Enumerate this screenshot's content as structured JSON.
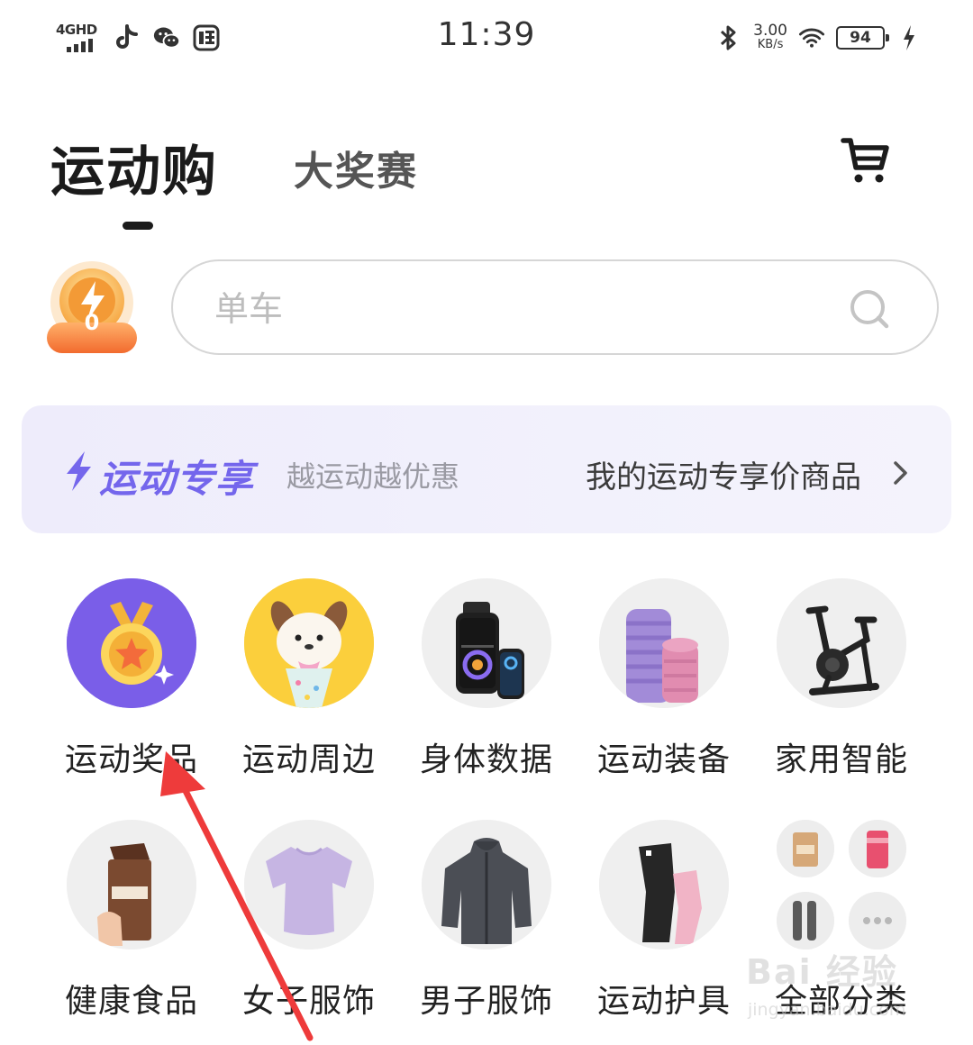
{
  "status_bar": {
    "network": "4GHD",
    "time": "11:39",
    "speed_value": "3.00",
    "speed_unit": "KB/s",
    "battery": "94",
    "left_icons": [
      "douyin-icon",
      "wechat-icon",
      "vip-shop-icon"
    ],
    "right_icons": [
      "bluetooth-icon",
      "wifi-icon",
      "charging-icon"
    ]
  },
  "header": {
    "tabs": [
      {
        "label": "运动购",
        "active": true
      },
      {
        "label": "大奖赛",
        "active": false
      }
    ],
    "cart_icon": "cart-icon"
  },
  "energy": {
    "count": "0",
    "icon": "lightning-coin-icon"
  },
  "search": {
    "placeholder": "单车",
    "value": ""
  },
  "banner": {
    "title": "运动专享",
    "subtitle": "越运动越优惠",
    "link": "我的运动专享价商品",
    "accent": "#7466ec"
  },
  "categories": [
    {
      "label": "运动奖品",
      "icon": "medal-icon"
    },
    {
      "label": "运动周边",
      "icon": "plush-toy-icon"
    },
    {
      "label": "身体数据",
      "icon": "smartwatch-icon"
    },
    {
      "label": "运动装备",
      "icon": "foam-roller-icon"
    },
    {
      "label": "家用智能",
      "icon": "exercise-bike-icon"
    },
    {
      "label": "健康食品",
      "icon": "protein-bar-icon"
    },
    {
      "label": "女子服饰",
      "icon": "women-tshirt-icon"
    },
    {
      "label": "男子服饰",
      "icon": "men-jacket-icon"
    },
    {
      "label": "运动护具",
      "icon": "knee-brace-icon"
    },
    {
      "label": "全部分类",
      "icon": "all-categories-icon"
    }
  ],
  "annotation": {
    "arrow_color": "#ee3b3b"
  },
  "watermark": {
    "main": "Bai 经验",
    "sub": "jingyan.baidu.com"
  }
}
